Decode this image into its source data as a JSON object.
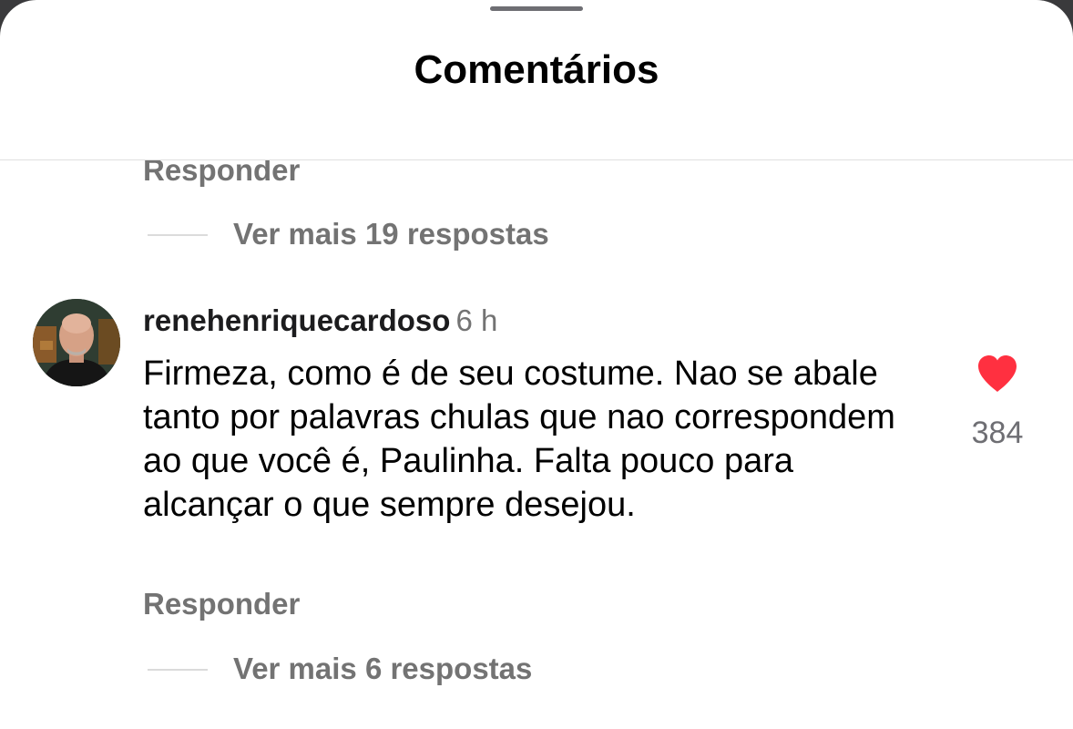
{
  "header": {
    "title": "Comentários"
  },
  "previous_thread": {
    "reply_label": "Responder",
    "more_replies": "Ver mais 19 respostas"
  },
  "comment": {
    "username": "renehenriquecardoso",
    "time": "6 h",
    "text": "Firmeza, como é de seu costume. Nao se abale tanto por palavras chulas que nao correspondem ao que você é, Paulinha. Falta pouco para alcançar o que sempre desejou.",
    "like_count": "384",
    "like_icon": "heart-icon",
    "like_color": "#ff3040",
    "reply_label": "Responder",
    "more_replies": "Ver mais 6 respostas"
  }
}
